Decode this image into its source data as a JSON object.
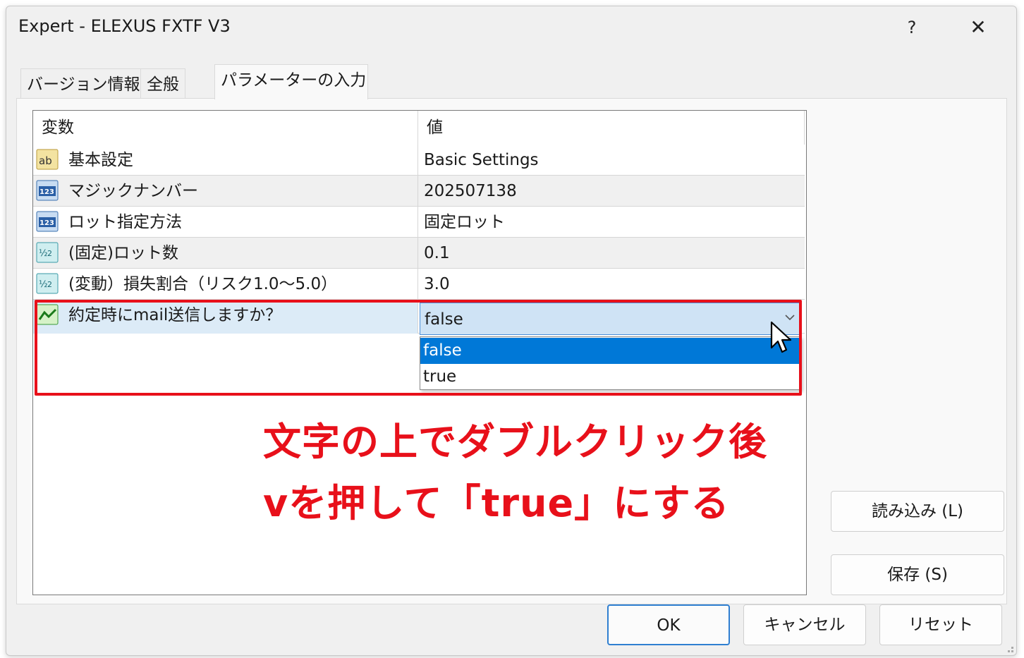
{
  "window": {
    "title": "Expert - ELEXUS FXTF V3",
    "help_label": "?",
    "close_label": "✕"
  },
  "tabs": [
    {
      "label": "バージョン情報"
    },
    {
      "label": "全般"
    },
    {
      "label": "パラメーターの入力"
    }
  ],
  "grid": {
    "columns": [
      "変数",
      "値"
    ],
    "rows": [
      {
        "icon": "ab",
        "name": "基本設定",
        "value": "Basic Settings"
      },
      {
        "icon": "123",
        "name": "マジックナンバー",
        "value": "202507138"
      },
      {
        "icon": "123",
        "name": "ロット指定方法",
        "value": "固定ロット"
      },
      {
        "icon": "v2",
        "name": "(固定)ロット数",
        "value": "0.1"
      },
      {
        "icon": "v2",
        "name": "(変動）損失割合（リスク1.0〜5.0）",
        "value": "3.0"
      },
      {
        "icon": "bool",
        "name": "約定時にmail送信しますか？",
        "value": "false"
      }
    ],
    "dropdown_options": [
      "false",
      "true"
    ]
  },
  "annotation": {
    "line1": "文字の上でダブルクリック後",
    "line2": "vを押して「true」にする"
  },
  "buttons": {
    "load": "読み込み (L)",
    "save": "保存 (S)",
    "ok": "OK",
    "cancel": "キャンセル",
    "reset": "リセット"
  },
  "colors": {
    "highlight": "#e8101a",
    "selection": "#0078d7"
  }
}
